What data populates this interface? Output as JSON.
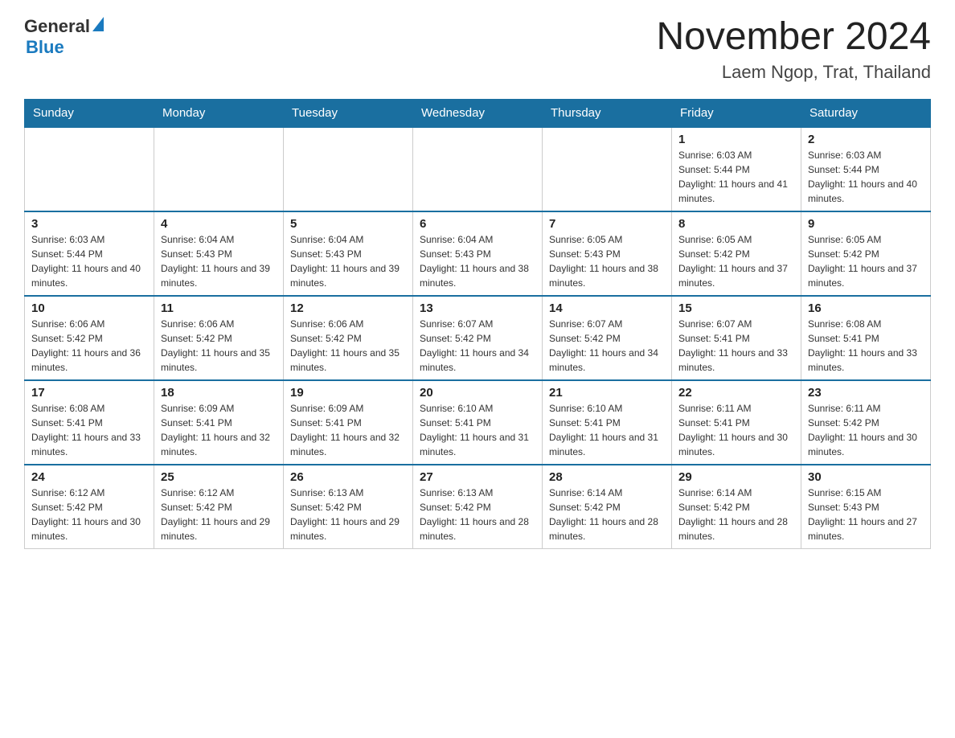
{
  "header": {
    "logo_general": "General",
    "logo_blue": "Blue",
    "main_title": "November 2024",
    "subtitle": "Laem Ngop, Trat, Thailand"
  },
  "weekdays": [
    "Sunday",
    "Monday",
    "Tuesday",
    "Wednesday",
    "Thursday",
    "Friday",
    "Saturday"
  ],
  "weeks": [
    [
      {
        "day": "",
        "info": ""
      },
      {
        "day": "",
        "info": ""
      },
      {
        "day": "",
        "info": ""
      },
      {
        "day": "",
        "info": ""
      },
      {
        "day": "",
        "info": ""
      },
      {
        "day": "1",
        "info": "Sunrise: 6:03 AM\nSunset: 5:44 PM\nDaylight: 11 hours and 41 minutes."
      },
      {
        "day": "2",
        "info": "Sunrise: 6:03 AM\nSunset: 5:44 PM\nDaylight: 11 hours and 40 minutes."
      }
    ],
    [
      {
        "day": "3",
        "info": "Sunrise: 6:03 AM\nSunset: 5:44 PM\nDaylight: 11 hours and 40 minutes."
      },
      {
        "day": "4",
        "info": "Sunrise: 6:04 AM\nSunset: 5:43 PM\nDaylight: 11 hours and 39 minutes."
      },
      {
        "day": "5",
        "info": "Sunrise: 6:04 AM\nSunset: 5:43 PM\nDaylight: 11 hours and 39 minutes."
      },
      {
        "day": "6",
        "info": "Sunrise: 6:04 AM\nSunset: 5:43 PM\nDaylight: 11 hours and 38 minutes."
      },
      {
        "day": "7",
        "info": "Sunrise: 6:05 AM\nSunset: 5:43 PM\nDaylight: 11 hours and 38 minutes."
      },
      {
        "day": "8",
        "info": "Sunrise: 6:05 AM\nSunset: 5:42 PM\nDaylight: 11 hours and 37 minutes."
      },
      {
        "day": "9",
        "info": "Sunrise: 6:05 AM\nSunset: 5:42 PM\nDaylight: 11 hours and 37 minutes."
      }
    ],
    [
      {
        "day": "10",
        "info": "Sunrise: 6:06 AM\nSunset: 5:42 PM\nDaylight: 11 hours and 36 minutes."
      },
      {
        "day": "11",
        "info": "Sunrise: 6:06 AM\nSunset: 5:42 PM\nDaylight: 11 hours and 35 minutes."
      },
      {
        "day": "12",
        "info": "Sunrise: 6:06 AM\nSunset: 5:42 PM\nDaylight: 11 hours and 35 minutes."
      },
      {
        "day": "13",
        "info": "Sunrise: 6:07 AM\nSunset: 5:42 PM\nDaylight: 11 hours and 34 minutes."
      },
      {
        "day": "14",
        "info": "Sunrise: 6:07 AM\nSunset: 5:42 PM\nDaylight: 11 hours and 34 minutes."
      },
      {
        "day": "15",
        "info": "Sunrise: 6:07 AM\nSunset: 5:41 PM\nDaylight: 11 hours and 33 minutes."
      },
      {
        "day": "16",
        "info": "Sunrise: 6:08 AM\nSunset: 5:41 PM\nDaylight: 11 hours and 33 minutes."
      }
    ],
    [
      {
        "day": "17",
        "info": "Sunrise: 6:08 AM\nSunset: 5:41 PM\nDaylight: 11 hours and 33 minutes."
      },
      {
        "day": "18",
        "info": "Sunrise: 6:09 AM\nSunset: 5:41 PM\nDaylight: 11 hours and 32 minutes."
      },
      {
        "day": "19",
        "info": "Sunrise: 6:09 AM\nSunset: 5:41 PM\nDaylight: 11 hours and 32 minutes."
      },
      {
        "day": "20",
        "info": "Sunrise: 6:10 AM\nSunset: 5:41 PM\nDaylight: 11 hours and 31 minutes."
      },
      {
        "day": "21",
        "info": "Sunrise: 6:10 AM\nSunset: 5:41 PM\nDaylight: 11 hours and 31 minutes."
      },
      {
        "day": "22",
        "info": "Sunrise: 6:11 AM\nSunset: 5:41 PM\nDaylight: 11 hours and 30 minutes."
      },
      {
        "day": "23",
        "info": "Sunrise: 6:11 AM\nSunset: 5:42 PM\nDaylight: 11 hours and 30 minutes."
      }
    ],
    [
      {
        "day": "24",
        "info": "Sunrise: 6:12 AM\nSunset: 5:42 PM\nDaylight: 11 hours and 30 minutes."
      },
      {
        "day": "25",
        "info": "Sunrise: 6:12 AM\nSunset: 5:42 PM\nDaylight: 11 hours and 29 minutes."
      },
      {
        "day": "26",
        "info": "Sunrise: 6:13 AM\nSunset: 5:42 PM\nDaylight: 11 hours and 29 minutes."
      },
      {
        "day": "27",
        "info": "Sunrise: 6:13 AM\nSunset: 5:42 PM\nDaylight: 11 hours and 28 minutes."
      },
      {
        "day": "28",
        "info": "Sunrise: 6:14 AM\nSunset: 5:42 PM\nDaylight: 11 hours and 28 minutes."
      },
      {
        "day": "29",
        "info": "Sunrise: 6:14 AM\nSunset: 5:42 PM\nDaylight: 11 hours and 28 minutes."
      },
      {
        "day": "30",
        "info": "Sunrise: 6:15 AM\nSunset: 5:43 PM\nDaylight: 11 hours and 27 minutes."
      }
    ]
  ]
}
